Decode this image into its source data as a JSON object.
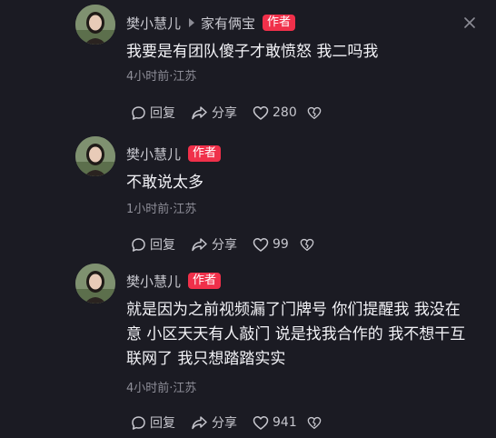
{
  "comments": [
    {
      "username": "樊小慧儿",
      "reply_to": "家有俩宝",
      "badge": "作者",
      "text": "我要是有团队傻子才敢愤怒 我二吗我",
      "meta": "4小时前·江苏",
      "reply_label": "回复",
      "share_label": "分享",
      "likes": "280"
    },
    {
      "username": "樊小慧儿",
      "badge": "作者",
      "text": "不敢说太多",
      "meta": "1小时前·江苏",
      "reply_label": "回复",
      "share_label": "分享",
      "likes": "99"
    },
    {
      "username": "樊小慧儿",
      "badge": "作者",
      "text": "就是因为之前视频漏了门牌号 你们提醒我 我没在\n意 小区天天有人敲门 说是找我合作的 我不想干互\n联网了 我只想踏踏实实",
      "meta": "4小时前·江苏",
      "reply_label": "回复",
      "share_label": "分享",
      "likes": "941"
    }
  ],
  "icons": {
    "more": "more-x-icon",
    "reply": "reply-bubble-icon",
    "share": "share-arrow-icon",
    "like": "heart-icon",
    "dislike": "broken-heart-icon"
  },
  "colors": {
    "background": "#1b1b23",
    "badge": "#f0304a",
    "text": "#f2f2f6",
    "meta": "#8e8e98"
  }
}
